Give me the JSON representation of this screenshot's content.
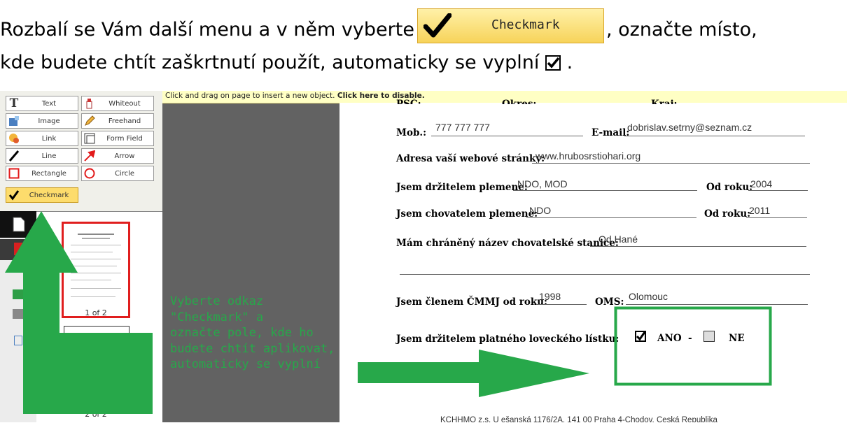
{
  "instruction": {
    "line1_before": "Rozbalí se Vám další menu a v něm vyberte",
    "button_label": "Checkmark",
    "line1_after": ", označte místo,",
    "line2": "kde budete chtít zaškrtnutí použít, automaticky se vyplní",
    "line2_end": "."
  },
  "notice": {
    "text": "Click and drag on page to insert a new object.",
    "link": "Click here to disable."
  },
  "toolbar": {
    "items": [
      {
        "label": "Text",
        "icon": "text-icon"
      },
      {
        "label": "Whiteout",
        "icon": "whiteout-icon"
      },
      {
        "label": "Image",
        "icon": "image-icon"
      },
      {
        "label": "Freehand",
        "icon": "pencil-icon"
      },
      {
        "label": "Link",
        "icon": "link-icon"
      },
      {
        "label": "Form Field",
        "icon": "form-field-icon"
      },
      {
        "label": "Line",
        "icon": "line-icon"
      },
      {
        "label": "Arrow",
        "icon": "arrow-icon"
      },
      {
        "label": "Rectangle",
        "icon": "rectangle-icon"
      },
      {
        "label": "Circle",
        "icon": "circle-icon"
      },
      {
        "label": "Checkmark",
        "icon": "checkmark-icon",
        "selected": true
      }
    ]
  },
  "thumbnails": {
    "page1": "1 of 2",
    "page2": "2 of 2"
  },
  "callout": {
    "text": "Vyberte odkaz\n\"Checkmark\" a\noznačte pole, kde ho\nbudete chtít aplikovat,\nautomaticky se vyplní"
  },
  "form": {
    "row0": {
      "a": "PSČ:",
      "b": "Okres:",
      "c": "Kraj:"
    },
    "mob": {
      "label": "Mob.:",
      "value": "777 777 777",
      "email_label": "E-mail:",
      "email_value": "dobrislav.setrny@seznam.cz"
    },
    "web": {
      "label": "Adresa vaší webové stránky:",
      "value": "www.hrubosrstiohari.org"
    },
    "drz": {
      "label": "Jsem držitelem plemene:",
      "value": "NDO, MOD",
      "od_label": "Od roku:",
      "od_value": "2004"
    },
    "chov": {
      "label": "Jsem chovatelem plemene:",
      "value": "NDO",
      "od_label": "Od roku:",
      "od_value": "2011"
    },
    "nazev": {
      "label": "Mám chráněný název chovatelské stanice:",
      "value": "Od Hané"
    },
    "clen": {
      "label": "Jsem členem ČMMJ od roku:",
      "value": "1998",
      "oms_label": "OMS:",
      "oms_value": "Olomouc"
    },
    "listek": {
      "label": "Jsem držitelem platného loveckého lístku:",
      "ano": "ANO",
      "dash": "-",
      "ne": "NE",
      "ano_checked": true,
      "ne_checked": false
    }
  },
  "footer": {
    "text": "KCHHMO z.s. U ešanská 1176/2A, 141 00 Praha 4-Chodov, Česká Republika"
  },
  "colors": {
    "accent_green": "#27a84a",
    "button_yellow": "#f7d35a"
  }
}
